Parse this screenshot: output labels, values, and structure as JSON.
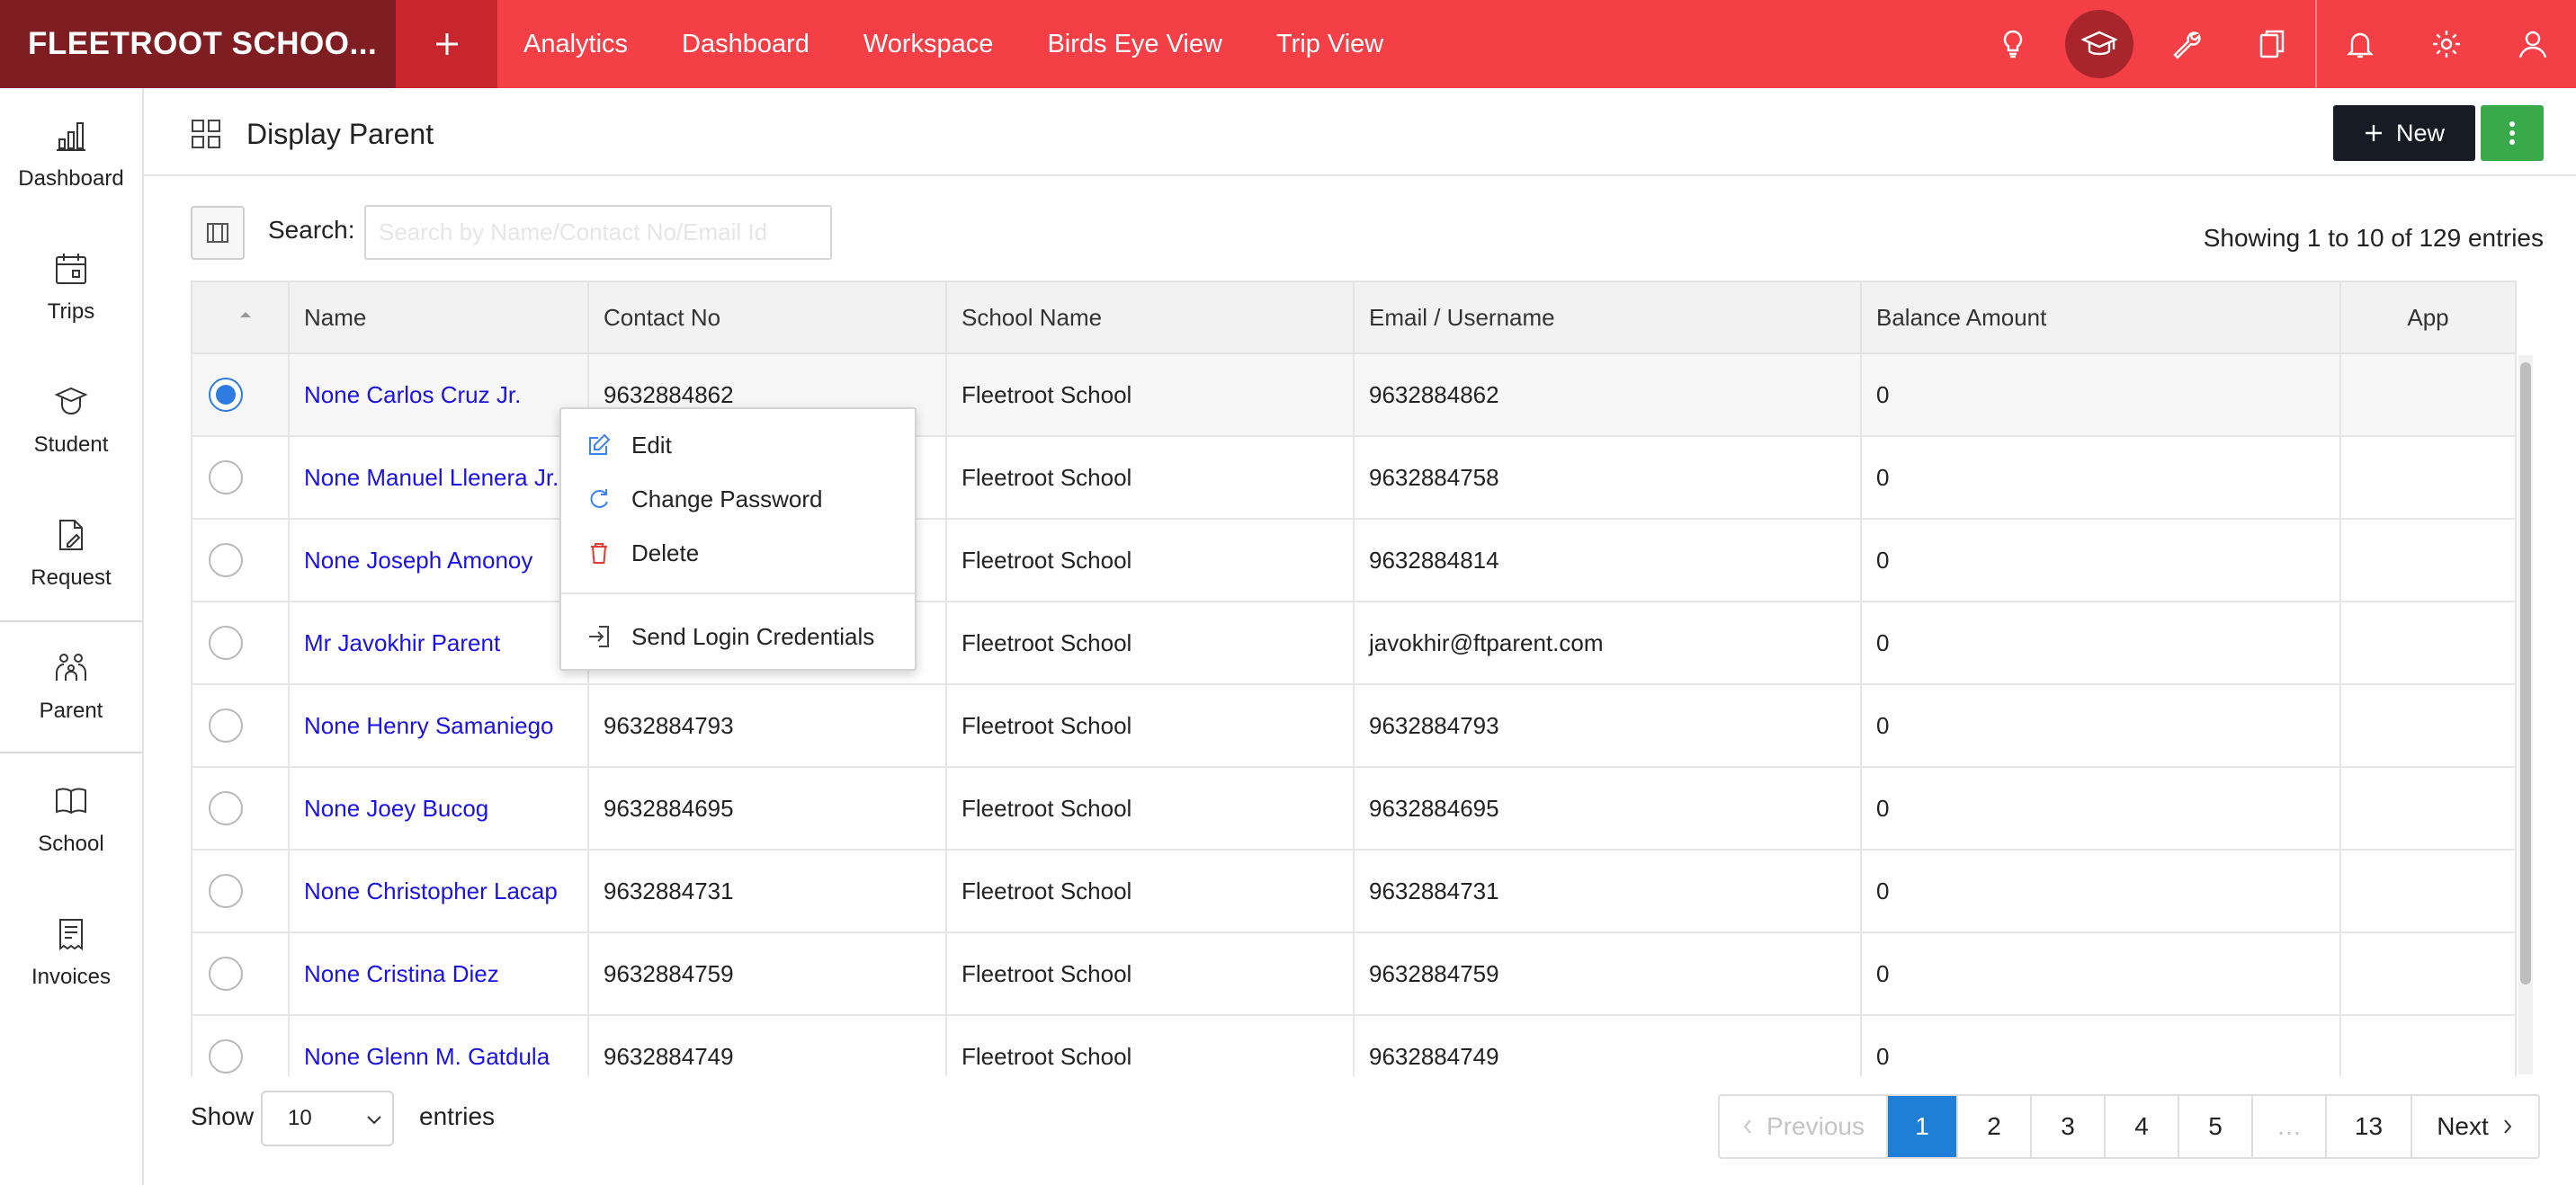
{
  "app": {
    "brand": "FLEETROOT SCHOO..."
  },
  "nav": [
    "Analytics",
    "Dashboard",
    "Workspace",
    "Birds Eye View",
    "Trip View"
  ],
  "top_icons": [
    "lightbulb-icon",
    "graduation-cap-icon",
    "wrench-icon",
    "documents-icon",
    "bell-icon",
    "gear-icon",
    "user-icon"
  ],
  "sidebar": {
    "items": [
      {
        "label": "Dashboard",
        "icon": "chart-icon"
      },
      {
        "label": "Trips",
        "icon": "calendar-icon"
      },
      {
        "label": "Student",
        "icon": "student-icon"
      },
      {
        "label": "Request",
        "icon": "request-icon"
      },
      {
        "label": "Parent",
        "icon": "parent-icon",
        "active": true
      },
      {
        "label": "School",
        "icon": "book-icon"
      },
      {
        "label": "Invoices",
        "icon": "invoice-icon"
      }
    ]
  },
  "page": {
    "title": "Display Parent",
    "new_label": "New"
  },
  "search": {
    "label": "Search:",
    "value": "",
    "placeholder": "Search by Name/Contact No/Email Id"
  },
  "entries_info": "Showing 1 to 10 of 129 entries",
  "table": {
    "columns": [
      "",
      "Name",
      "Contact No",
      "School Name",
      "Email / Username",
      "Balance Amount",
      "App"
    ],
    "rows": [
      {
        "name": "None Carlos Cruz Jr.",
        "contact": "9632884862",
        "school": "Fleetroot School",
        "email": "9632884862",
        "balance": "0",
        "app": "",
        "selected": true
      },
      {
        "name": "None Manuel Llenera Jr.",
        "contact": "",
        "school": "Fleetroot School",
        "email": "9632884758",
        "balance": "0",
        "app": ""
      },
      {
        "name": "None Joseph Amonoy",
        "contact": "",
        "school": "Fleetroot School",
        "email": "9632884814",
        "balance": "0",
        "app": ""
      },
      {
        "name": "Mr Javokhir Parent",
        "contact": "",
        "school": "Fleetroot School",
        "email": "javokhir@ftparent.com",
        "balance": "0",
        "app": ""
      },
      {
        "name": "None Henry Samaniego",
        "contact": "9632884793",
        "school": "Fleetroot School",
        "email": "9632884793",
        "balance": "0",
        "app": ""
      },
      {
        "name": "None Joey Bucog",
        "contact": "9632884695",
        "school": "Fleetroot School",
        "email": "9632884695",
        "balance": "0",
        "app": ""
      },
      {
        "name": "None Christopher Lacap",
        "contact": "9632884731",
        "school": "Fleetroot School",
        "email": "9632884731",
        "balance": "0",
        "app": ""
      },
      {
        "name": "None Cristina Diez",
        "contact": "9632884759",
        "school": "Fleetroot School",
        "email": "9632884759",
        "balance": "0",
        "app": ""
      },
      {
        "name": "None Glenn M. Gatdula",
        "contact": "9632884749",
        "school": "Fleetroot School",
        "email": "9632884749",
        "balance": "0",
        "app": ""
      }
    ]
  },
  "context_menu": {
    "edit": "Edit",
    "change_password": "Change Password",
    "delete": "Delete",
    "send_credentials": "Send Login Credentials"
  },
  "footer": {
    "show_label": "Show",
    "page_size": "10",
    "entries_label": "entries",
    "pagination": {
      "previous": "Previous",
      "pages": [
        "1",
        "2",
        "3",
        "4",
        "5",
        "…",
        "13"
      ],
      "current": "1",
      "next": "Next"
    }
  },
  "colors": {
    "topbar": "#f43f46",
    "brand_bg": "#7f1e22",
    "link": "#1a12e6",
    "primary": "#1f7fd6",
    "new_btn": "#161b24",
    "more_btn": "#3aa94a"
  }
}
